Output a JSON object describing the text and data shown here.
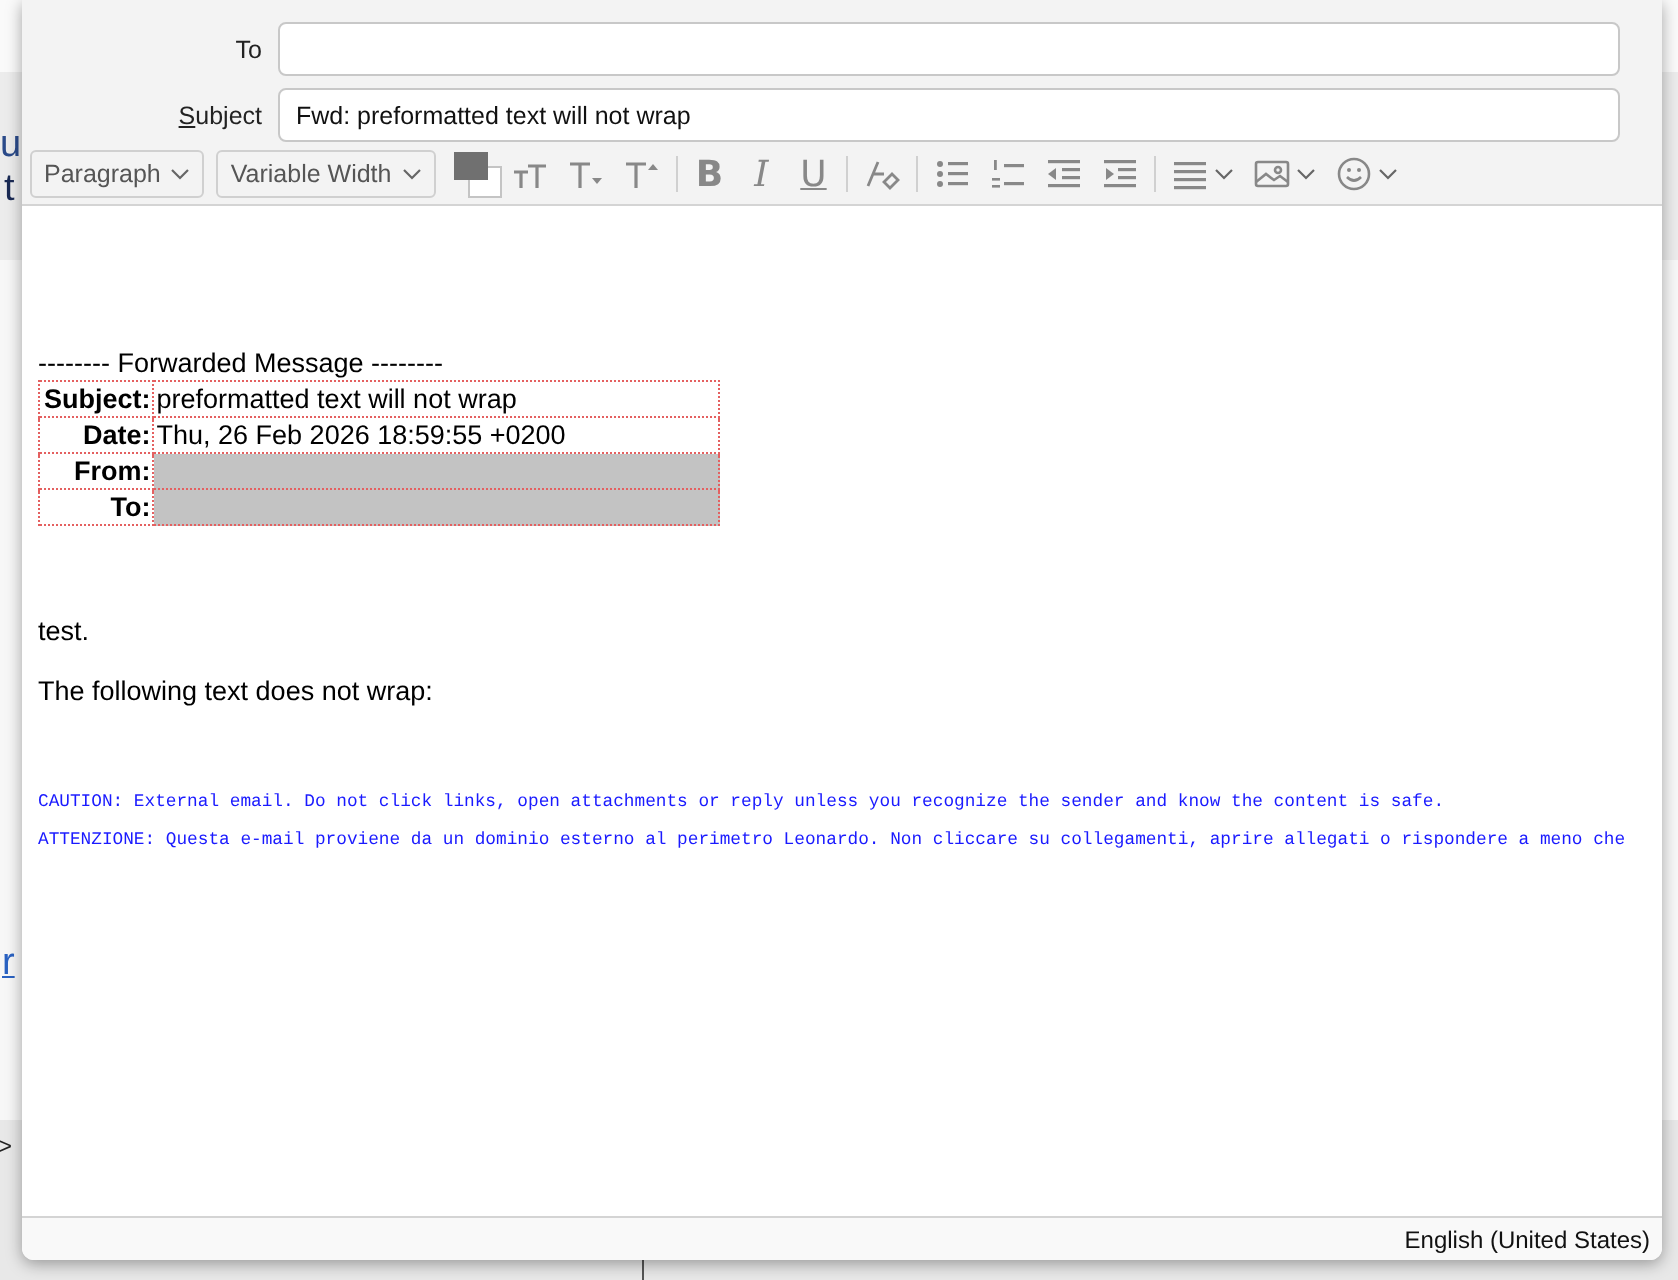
{
  "background_fragments": [
    "u",
    "t",
    "r",
    ">"
  ],
  "header": {
    "to": {
      "label": "To"
    },
    "subject": {
      "label": "Subject",
      "value": "Fwd: preformatted text will not wrap"
    }
  },
  "toolbar": [
    {
      "kind": "dropdown",
      "label": "Paragraph"
    },
    {
      "kind": "dropdown",
      "label": "Variable Width"
    },
    {
      "kind": "color"
    },
    {
      "kind": "shrink"
    },
    {
      "kind": "smaller"
    },
    {
      "kind": "larger"
    },
    {
      "kind": "sep"
    },
    {
      "kind": "bold",
      "label": "B"
    },
    {
      "kind": "italic",
      "label": "I"
    },
    {
      "kind": "underline",
      "label": "U"
    },
    {
      "kind": "sep"
    },
    {
      "kind": "eraser"
    },
    {
      "kind": "sep"
    },
    {
      "kind": "bullets"
    },
    {
      "kind": "numbers"
    },
    {
      "kind": "outdent"
    },
    {
      "kind": "indent"
    },
    {
      "kind": "sep"
    },
    {
      "kind": "align"
    },
    {
      "kind": "image"
    },
    {
      "kind": "emoji"
    }
  ],
  "body": {
    "forward_header": "-------- Forwarded Message --------",
    "fields": [
      {
        "label": "Subject:",
        "value": "preformatted text will not wrap",
        "redacted": false
      },
      {
        "label": "Date:",
        "value": "Thu, 26 Feb 2026 18:59:55 +0200",
        "redacted": false
      },
      {
        "label": "From:",
        "redacted": true
      },
      {
        "label": "To:",
        "redacted": true
      }
    ],
    "paragraphs": [
      "test.",
      "The following text does not wrap:"
    ],
    "preformatted": [
      "CAUTION: External email. Do not click links, open attachments or reply unless you recognize the sender and know the content is safe.",
      "ATTENZIONE: Questa e-mail proviene da un dominio esterno al perimetro Leonardo. Non cliccare su collegamenti, aprire allegati o rispondere a meno che"
    ]
  },
  "status_bar": {
    "language": "English (United States)"
  }
}
